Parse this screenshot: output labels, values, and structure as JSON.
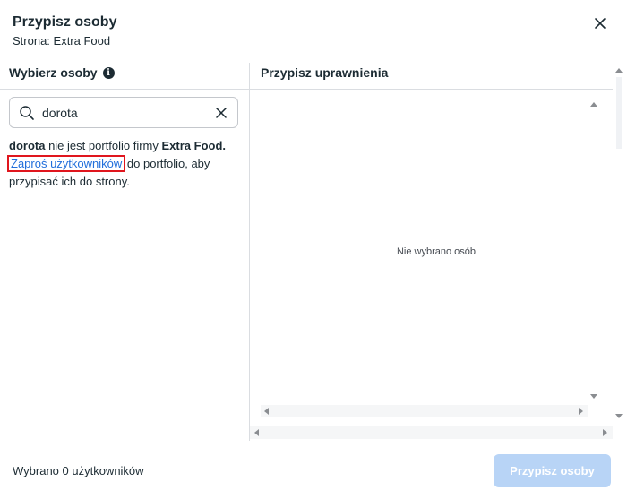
{
  "dialog": {
    "title": "Przypisz osoby",
    "subtitle": "Strona: Extra Food"
  },
  "left_panel": {
    "title": "Wybierz osoby",
    "search": {
      "value": "dorota",
      "placeholder": ""
    },
    "message": {
      "name": "dorota",
      "part1": " nie jest portfolio firmy ",
      "company": "Extra Food.",
      "link": "Zaproś użytkowników",
      "part2": " do portfolio, aby przypisać ich do strony."
    }
  },
  "right_panel": {
    "title": "Przypisz uprawnienia",
    "empty_text": "Nie wybrano osób"
  },
  "footer": {
    "selected_text": "Wybrano 0 użytkowników",
    "assign_button": "Przypisz osoby"
  },
  "colors": {
    "link": "#216fdb",
    "highlight": "#e0161e",
    "button_disabled": "#b8d4f6"
  },
  "icons": [
    "close-icon",
    "info-icon",
    "search-icon",
    "clear-icon"
  ]
}
